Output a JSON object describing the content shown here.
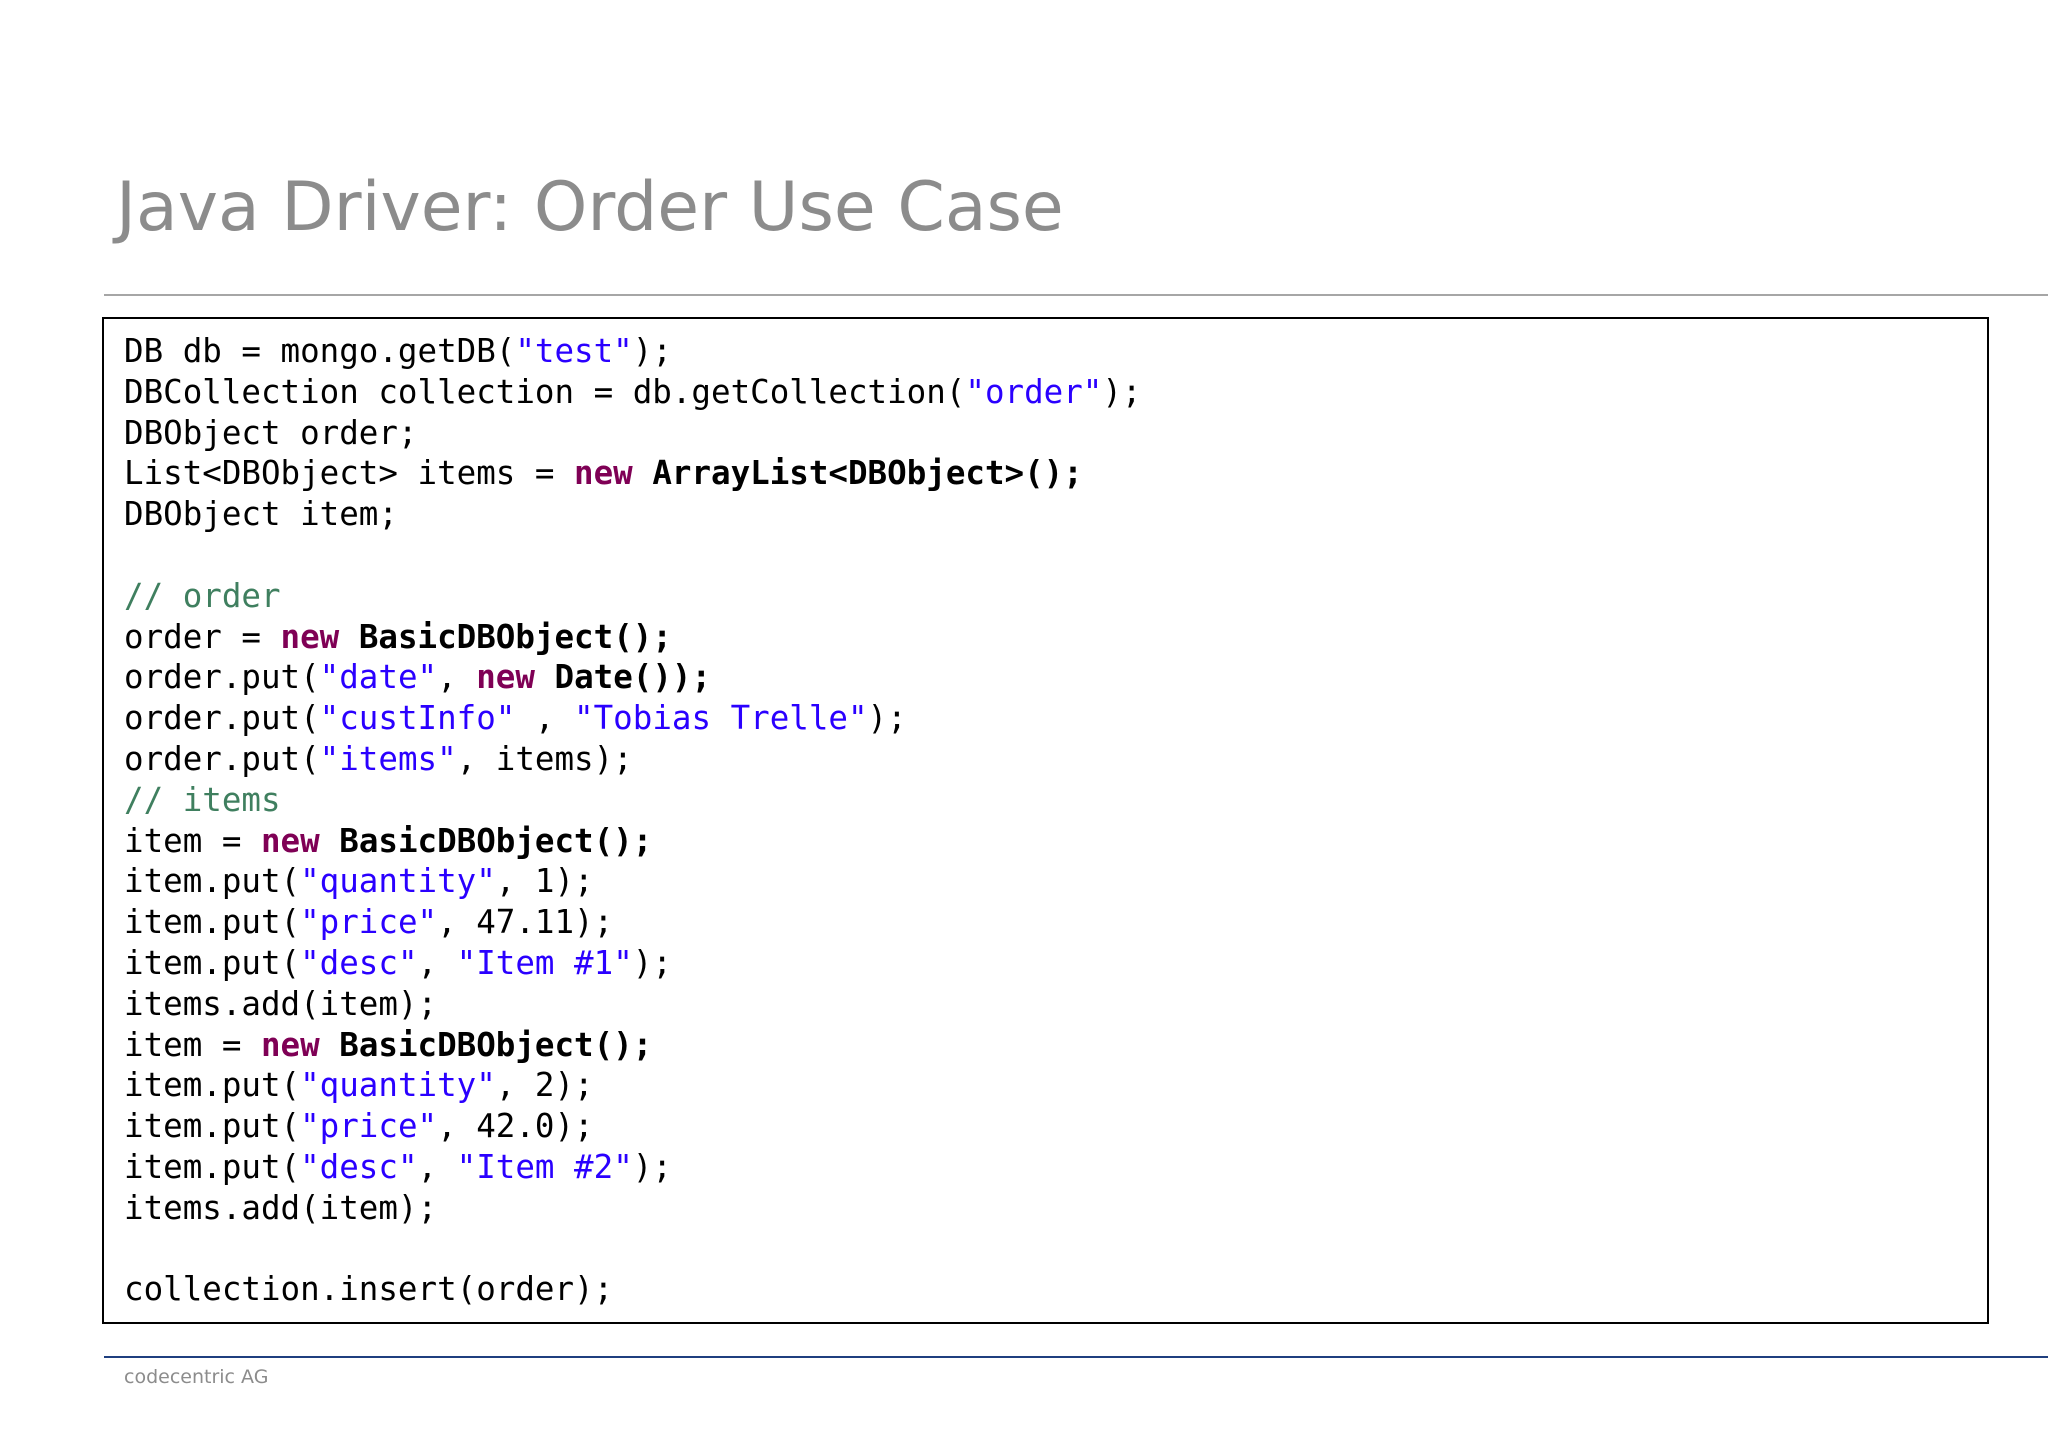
{
  "slide": {
    "title": "Java Driver: Order Use Case",
    "footer": "codecentric AG"
  },
  "code": {
    "language": "java",
    "colors": {
      "string": "#2a00ff",
      "keyword": "#7f0055",
      "comment": "#3f7f5f",
      "plain": "#000000"
    },
    "lines": [
      [
        {
          "t": "DB db = mongo.getDB("
        },
        {
          "t": "\"test\"",
          "k": "str"
        },
        {
          "t": ");"
        }
      ],
      [
        {
          "t": "DBCollection collection = db.getCollection("
        },
        {
          "t": "\"order\"",
          "k": "str"
        },
        {
          "t": ");"
        }
      ],
      [
        {
          "t": "DBObject order;"
        }
      ],
      [
        {
          "t": "List<DBObject> items = "
        },
        {
          "t": "new",
          "k": "kw"
        },
        {
          "t": " "
        },
        {
          "t": "ArrayList<DBObject>();",
          "k": "bold"
        }
      ],
      [
        {
          "t": "DBObject item;"
        }
      ],
      [],
      [
        {
          "t": "// order",
          "k": "comment"
        }
      ],
      [
        {
          "t": "order = "
        },
        {
          "t": "new",
          "k": "kw"
        },
        {
          "t": " "
        },
        {
          "t": "BasicDBObject();",
          "k": "bold"
        }
      ],
      [
        {
          "t": "order.put("
        },
        {
          "t": "\"date\"",
          "k": "str"
        },
        {
          "t": ", "
        },
        {
          "t": "new",
          "k": "kw"
        },
        {
          "t": " "
        },
        {
          "t": "Date());",
          "k": "bold"
        }
      ],
      [
        {
          "t": "order.put("
        },
        {
          "t": "\"custInfo\"",
          "k": "str"
        },
        {
          "t": " , "
        },
        {
          "t": "\"Tobias Trelle\"",
          "k": "str"
        },
        {
          "t": ");"
        }
      ],
      [
        {
          "t": "order.put("
        },
        {
          "t": "\"items\"",
          "k": "str"
        },
        {
          "t": ", items);"
        }
      ],
      [
        {
          "t": "// items",
          "k": "comment"
        }
      ],
      [
        {
          "t": "item = "
        },
        {
          "t": "new",
          "k": "kw"
        },
        {
          "t": " "
        },
        {
          "t": "BasicDBObject();",
          "k": "bold"
        }
      ],
      [
        {
          "t": "item.put("
        },
        {
          "t": "\"quantity\"",
          "k": "str"
        },
        {
          "t": ", 1);"
        }
      ],
      [
        {
          "t": "item.put("
        },
        {
          "t": "\"price\"",
          "k": "str"
        },
        {
          "t": ", 47.11);"
        }
      ],
      [
        {
          "t": "item.put("
        },
        {
          "t": "\"desc\"",
          "k": "str"
        },
        {
          "t": ", "
        },
        {
          "t": "\"Item #1\"",
          "k": "str"
        },
        {
          "t": ");"
        }
      ],
      [
        {
          "t": "items.add(item);"
        }
      ],
      [
        {
          "t": "item = "
        },
        {
          "t": "new",
          "k": "kw"
        },
        {
          "t": " "
        },
        {
          "t": "BasicDBObject();",
          "k": "bold"
        }
      ],
      [
        {
          "t": "item.put("
        },
        {
          "t": "\"quantity\"",
          "k": "str"
        },
        {
          "t": ", 2);"
        }
      ],
      [
        {
          "t": "item.put("
        },
        {
          "t": "\"price\"",
          "k": "str"
        },
        {
          "t": ", 42.0);"
        }
      ],
      [
        {
          "t": "item.put("
        },
        {
          "t": "\"desc\"",
          "k": "str"
        },
        {
          "t": ", "
        },
        {
          "t": "\"Item #2\"",
          "k": "str"
        },
        {
          "t": ");"
        }
      ],
      [
        {
          "t": "items.add(item);"
        }
      ],
      [],
      [
        {
          "t": "collection.insert(order);"
        }
      ]
    ]
  }
}
